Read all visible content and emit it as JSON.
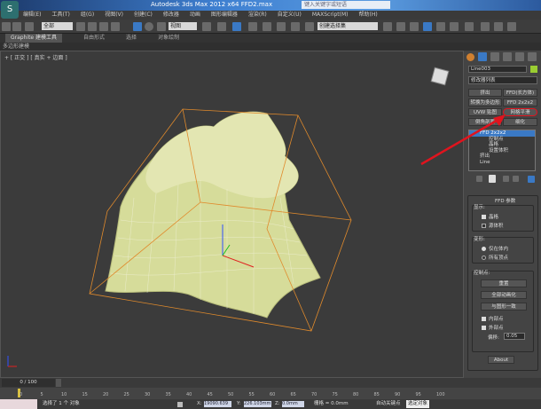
{
  "window": {
    "title": "Autodesk 3ds Max  2012 x64    FFD2.max",
    "search_placeholder": "键入关键字或短语",
    "logo": "S"
  },
  "menu": [
    "编辑(E)",
    "工具(T)",
    "组(G)",
    "视图(V)",
    "创建(C)",
    "修改器",
    "动画",
    "图形编辑器",
    "渲染(R)",
    "自定义(U)",
    "MAXScript(M)",
    "帮助(H)"
  ],
  "toolbar": {
    "selection_filter": "全部",
    "ref_coord": "视图",
    "named_sel": "创建选择集"
  },
  "ribbon": {
    "tabs": [
      "Graphite 建模工具",
      "自由形式",
      "选择",
      "对象绘制"
    ],
    "sub": "多边形建模"
  },
  "viewport": {
    "label": "+ [ 正交 ] [ 真实 + 边面 ]"
  },
  "panel": {
    "object_name": "Line003",
    "object_color": "#9acd32",
    "modifier_list": "修改器列表",
    "buttons": [
      "挤出",
      "FFD(长方体)",
      "转换为多边形",
      "FFD 2x2x2",
      "UVW 贴图",
      "网格平滑",
      "倒角剖面",
      "细化"
    ],
    "stack": [
      "FFD 2x2x2",
      "控制点",
      "晶格",
      "设置体积",
      "挤出",
      "Line"
    ],
    "rollout_title": "FFD 参数",
    "display": {
      "title": "显示:",
      "lattice": "晶格",
      "source_volume": "源体积",
      "lattice_checked": true,
      "source_volume_checked": false
    },
    "deform": {
      "title": "变形:",
      "inside": "仅在体内",
      "all": "所有顶点",
      "selected": "仅在体内"
    },
    "control": {
      "title": "控制点:",
      "reset": "重置",
      "animate_all": "全部动画化",
      "conform": "与图形一致",
      "inside_points": "内部点",
      "outside_points": "外部点",
      "offset_label": "偏移:",
      "offset": "0.05"
    },
    "about": "About"
  },
  "timeline": {
    "frame": "0 / 100",
    "ticks": [
      "0",
      "5",
      "10",
      "15",
      "20",
      "25",
      "30",
      "35",
      "40",
      "45",
      "50",
      "55",
      "60",
      "65",
      "70",
      "75",
      "80",
      "85",
      "90",
      "95",
      "100"
    ]
  },
  "status": {
    "message": "选择了 1 个 对象",
    "x_label": "X:",
    "x": "19090.639",
    "y_label": "Y:",
    "y": "226.103mm",
    "z_label": "Z:",
    "z": "0.0mm",
    "grid": "栅格 = 0.0mm",
    "autokey": "自动关键点",
    "selected": "选定对象"
  },
  "colors": {
    "mesh": "#d6dc9a",
    "lattice": "#e08a2c",
    "annotation": "#e0141e"
  }
}
